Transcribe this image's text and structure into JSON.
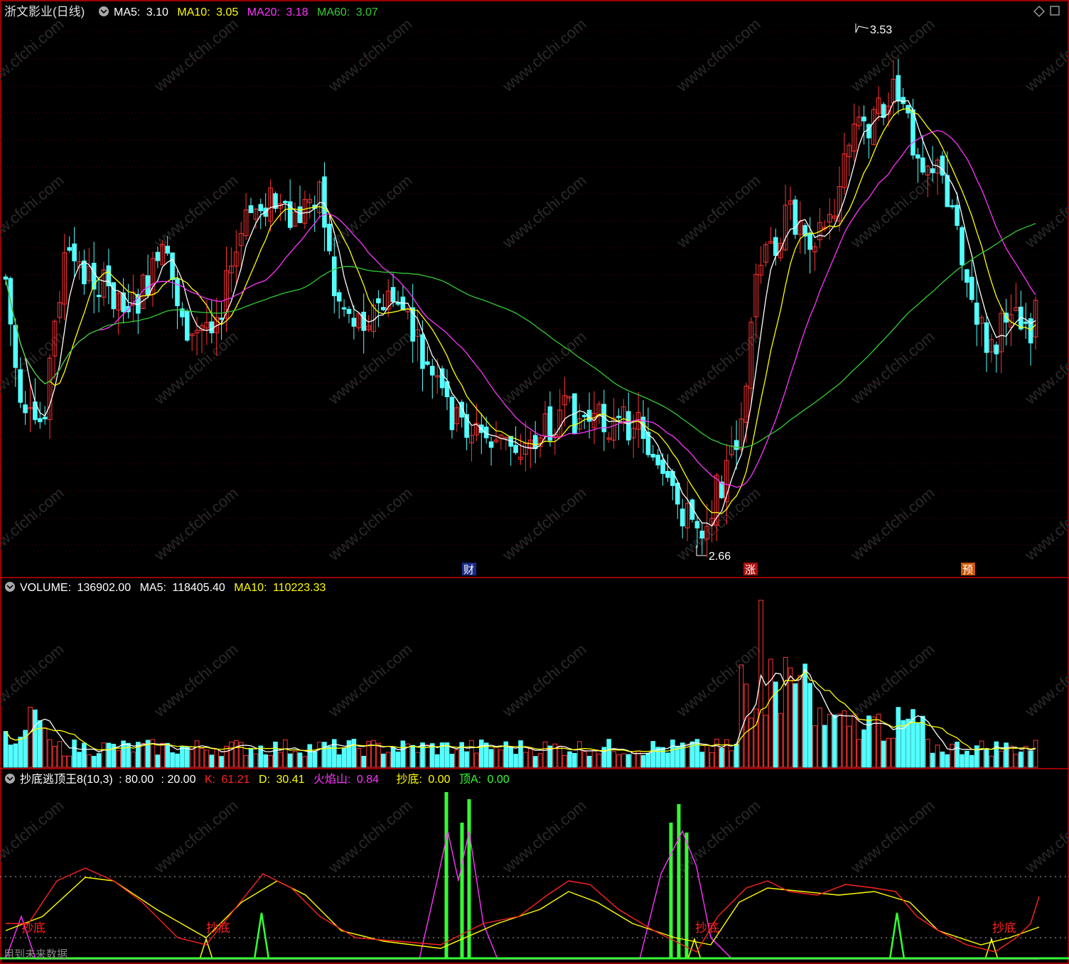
{
  "colors": {
    "up": "#ff3333",
    "down": "#54ffff",
    "ma5": "#ffffff",
    "ma10": "#ffff00",
    "ma20": "#ff33ff",
    "ma60": "#33cc33",
    "k": "#ff2222",
    "d": "#ffff00",
    "fire": "#ff33ff",
    "green": "#33ff33",
    "border": "#cc0000"
  },
  "main_panel": {
    "title": "浙文影业(日线)",
    "ma5_label": "MA5:",
    "ma5_value": "3.10",
    "ma10_label": "MA10:",
    "ma10_value": "3.05",
    "ma20_label": "MA20:",
    "ma20_value": "3.18",
    "ma60_label": "MA60:",
    "ma60_value": "3.07",
    "high_mark": "3.53",
    "low_mark": "2.66",
    "badges": [
      "财",
      "涨",
      "预"
    ],
    "icons": [
      "collapse-icon",
      "diamond-icon",
      "restore-icon"
    ]
  },
  "volume_panel": {
    "label": "VOLUME:",
    "value": "136902.00",
    "ma5_label": "MA5:",
    "ma5_value": "118405.40",
    "ma10_label": "MA10:",
    "ma10_value": "110223.33"
  },
  "indicator_panel": {
    "name": "抄底逃顶王8(10,3)",
    "upper": ": 80.00",
    "lower": ": 20.00",
    "k_label": "K:",
    "k_value": "61.21",
    "d_label": "D:",
    "d_value": "30.41",
    "fire_label": "火焰山:",
    "fire_value": "0.84",
    "bottom_label": "抄底:",
    "bottom_value": "0.00",
    "top_label": "顶A:",
    "top_value": "0.00",
    "signal_text": "抄底",
    "footer_text": "用到未来数据"
  },
  "watermark": "www.cfchi.com"
}
